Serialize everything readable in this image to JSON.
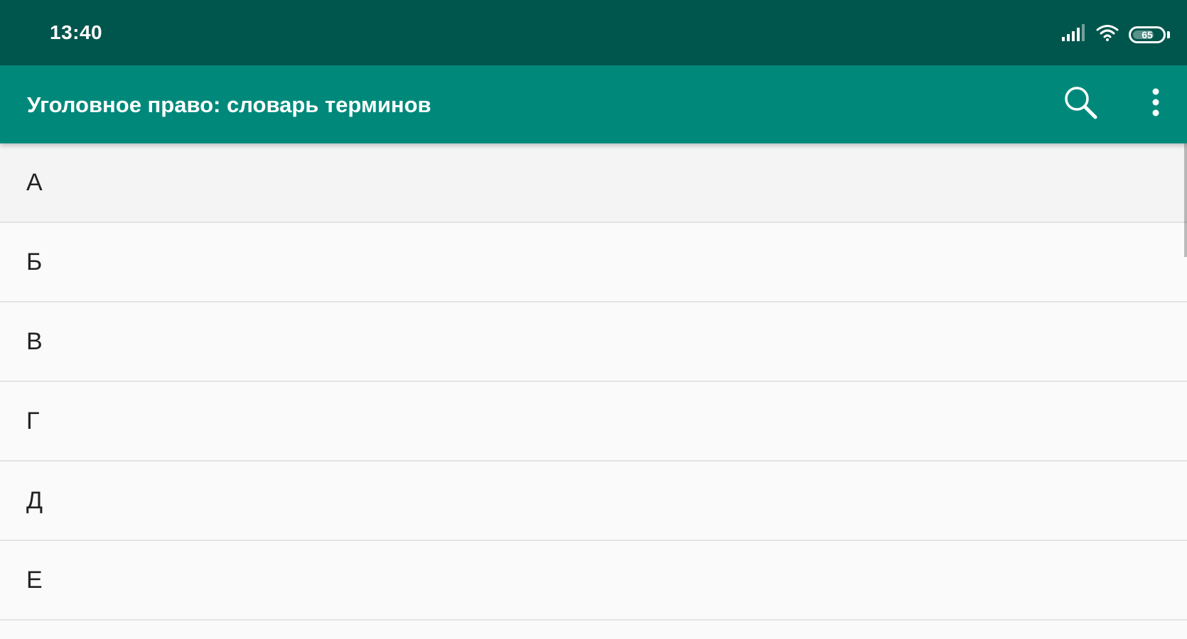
{
  "status_bar": {
    "time": "13:40",
    "battery_level": "65",
    "icons": [
      "signal-icon",
      "wifi-icon",
      "battery-icon"
    ]
  },
  "app_bar": {
    "title": "Уголовное право: словарь терминов",
    "actions": [
      "search-icon",
      "more-vert-icon"
    ]
  },
  "list": {
    "items": [
      {
        "label": "А"
      },
      {
        "label": "Б"
      },
      {
        "label": "В"
      },
      {
        "label": "Г"
      },
      {
        "label": "Д"
      },
      {
        "label": "Е"
      }
    ]
  },
  "colors": {
    "status_bar": "#00564d",
    "app_bar": "#00897b",
    "background": "#fafafa",
    "divider": "#e3e3e3",
    "text": "#222222"
  }
}
